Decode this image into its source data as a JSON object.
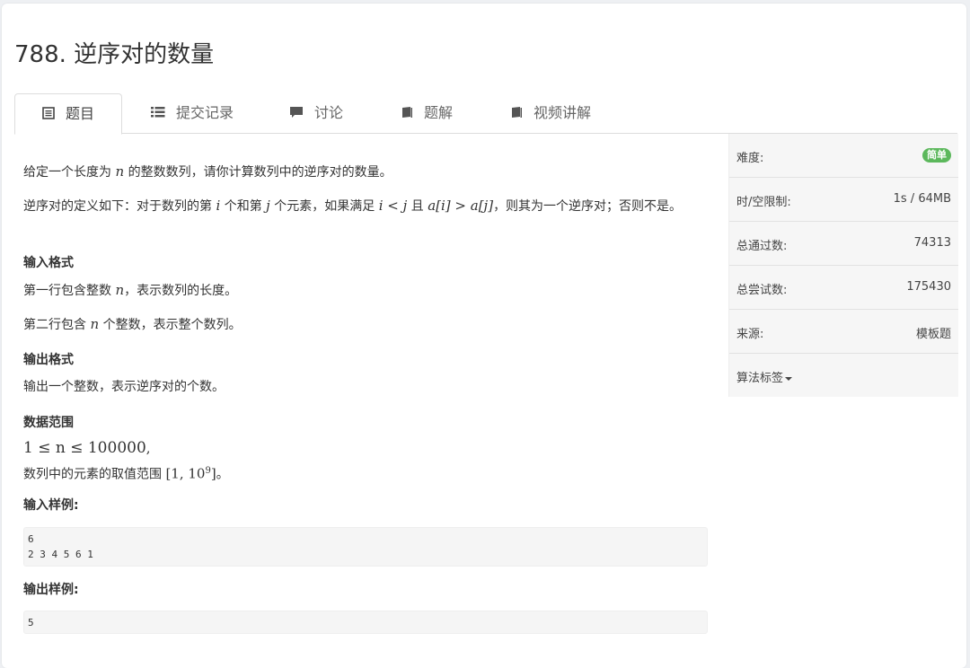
{
  "problem": {
    "title": "788. 逆序对的数量"
  },
  "tabs": [
    {
      "label": "题目",
      "icon": "list-alt-icon"
    },
    {
      "label": "提交记录",
      "icon": "list-icon"
    },
    {
      "label": "讨论",
      "icon": "comment-icon"
    },
    {
      "label": "题解",
      "icon": "book-icon"
    },
    {
      "label": "视频讲解",
      "icon": "book-icon"
    }
  ],
  "statement": {
    "p1_a": "给定一个长度为 ",
    "p1_n": "n",
    "p1_b": " 的整数数列，请你计算数列中的逆序对的数量。",
    "p2_a": "逆序对的定义如下：对于数列的第 ",
    "p2_i": "i",
    "p2_b": " 个和第 ",
    "p2_j": "j",
    "p2_c": " 个元素，如果满足 ",
    "p2_cond1": "i < j",
    "p2_d": " 且 ",
    "p2_cond2": "a[i] > a[j]",
    "p2_e": "，则其为一个逆序对；否则不是。",
    "input_format_heading": "输入格式",
    "input_line1_a": "第一行包含整数 ",
    "input_line1_n": "n",
    "input_line1_b": "，表示数列的长度。",
    "input_line2_a": "第二行包含 ",
    "input_line2_n": "n",
    "input_line2_b": " 个整数，表示整个数列。",
    "output_format_heading": "输出格式",
    "output_line": "输出一个整数，表示逆序对的个数。",
    "range_heading": "数据范围",
    "range_line1": "1 ≤ n ≤ 100000",
    "range_line1_tail": ",",
    "range_line2_a": "数列中的元素的取值范围 ",
    "range_line2_math": "[1, 10",
    "range_line2_sup": "9",
    "range_line2_close": "]",
    "range_line2_b": "。",
    "sample_input_heading": "输入样例:",
    "sample_input": "6\n2 3 4 5 6 1",
    "sample_output_heading": "输出样例:",
    "sample_output": "5"
  },
  "sidebar": {
    "difficulty_label": "难度:",
    "difficulty_value": "简单",
    "limit_label": "时/空限制:",
    "limit_value": "1s / 64MB",
    "passed_label": "总通过数:",
    "passed_value": "74313",
    "tried_label": "总尝试数:",
    "tried_value": "175430",
    "source_label": "来源:",
    "source_value": "模板题",
    "tags_label": "算法标签"
  },
  "colors": {
    "badge": "#5cb85c",
    "background": "#eef0f3"
  }
}
